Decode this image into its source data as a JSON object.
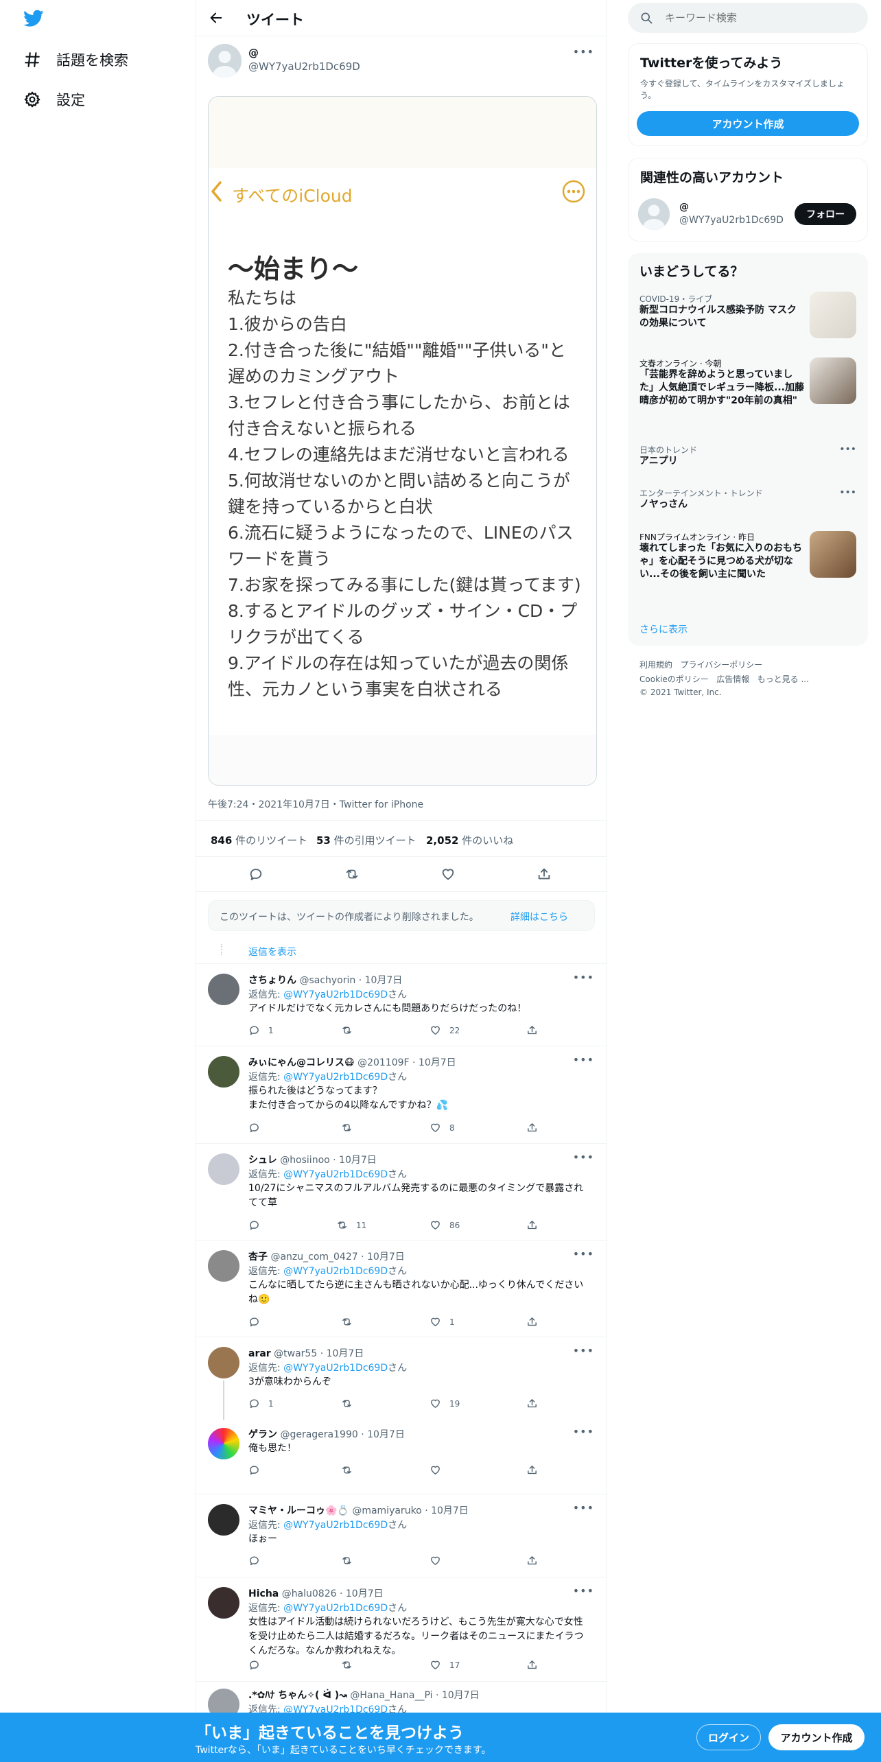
{
  "nav": {
    "explore_label": "話題を検索",
    "settings_label": "設定"
  },
  "header": {
    "title": "ツイート"
  },
  "tweet": {
    "name": "@",
    "handle": "@WY7yaU2rb1Dc69D",
    "image": {
      "back_label": "すべてのiCloud",
      "heading": "〜始まり〜",
      "lines": [
        "私たちは",
        "1.彼からの告白",
        "2.付き合った後に\"結婚\"\"離婚\"\"子供いる\"と",
        "遅めのカミングアウト",
        "3.セフレと付き合う事にしたから、お前とは",
        "付き合えないと振られる",
        "4.セフレの連絡先はまだ消せないと言われる",
        "5.何故消せないのかと問い詰めると向こうが",
        "鍵を持っているからと白状",
        "6.流石に疑うようになったので、LINEのパス",
        "ワードを貰う",
        "7.お家を探ってみる事にした(鍵は貰ってます)",
        "8.するとアイドルのグッズ・サイン・CD・プ",
        "リクラが出てくる",
        "9.アイドルの存在は知っていたが過去の関係",
        "性、元カノという事実を白状される"
      ]
    },
    "meta": "午後7:24・2021年10月7日・Twitter for iPhone",
    "stats": {
      "retweets": "846",
      "retweets_label": "件のリツイート",
      "quotes": "53",
      "quotes_label": "件の引用ツイート",
      "likes": "2,052",
      "likes_label": "件のいいね"
    },
    "deleted_notice": "このツイートは、ツイートの作成者により削除されました。",
    "deleted_link": "詳細はこちら",
    "show_replies": "返信を表示"
  },
  "replies": [
    {
      "name": "さちょりん",
      "handle": "@sachyorin · 10月7日",
      "to_prefix": "返信先: ",
      "to": "@WY7yaU2rb1Dc69D",
      "to_suffix": "さん",
      "text": "アイドルだけでなく元カレさんにも問題ありだらけだったのね！",
      "reply_count": "1",
      "rt_count": "",
      "like_count": "22"
    },
    {
      "name": "みぃにゃん@コレリス😷",
      "handle": "@201109F · 10月7日",
      "to_prefix": "返信先: ",
      "to": "@WY7yaU2rb1Dc69D",
      "to_suffix": "さん",
      "text": "振られた後はどうなってます？\nまた付き合ってからの4以降なんですかね？💦",
      "reply_count": "",
      "rt_count": "",
      "like_count": "8"
    },
    {
      "name": "シュレ",
      "handle": "@hosiinoo · 10月7日",
      "to_prefix": "返信先: ",
      "to": "@WY7yaU2rb1Dc69D",
      "to_suffix": "さん",
      "text": "10/27にシャニマスのフルアルバム発売するのに最悪のタイミングで暴露されてて草",
      "reply_count": "",
      "rt_count": "11",
      "like_count": "86"
    },
    {
      "name": "杏子",
      "handle": "@anzu_com_0427 · 10月7日",
      "to_prefix": "返信先: ",
      "to": "@WY7yaU2rb1Dc69D",
      "to_suffix": "さん",
      "text": "こんなに晒してたら逆に主さんも晒されないか心配...ゆっくり休んでくださいね🙂",
      "reply_count": "",
      "rt_count": "",
      "like_count": "1"
    },
    {
      "name": "arar",
      "handle": "@twar55 · 10月7日",
      "to_prefix": "返信先: ",
      "to": "@WY7yaU2rb1Dc69D",
      "to_suffix": "さん",
      "text": "3が意味わからんぞ",
      "reply_count": "1",
      "rt_count": "",
      "like_count": "19"
    },
    {
      "name": "ゲラン",
      "handle": "@geragera1990 · 10月7日",
      "to_prefix": "",
      "to": "",
      "to_suffix": "",
      "text": "俺も思た！",
      "reply_count": "",
      "rt_count": "",
      "like_count": ""
    },
    {
      "name": "マミヤ・ルーコゥ🌸💍",
      "handle": "@mamiyaruko · 10月7日",
      "to_prefix": "返信先: ",
      "to": "@WY7yaU2rb1Dc69D",
      "to_suffix": "さん",
      "text": "ほぉー",
      "reply_count": "",
      "rt_count": "",
      "like_count": ""
    },
    {
      "name": "Hicha",
      "handle": "@halu0826 · 10月7日",
      "to_prefix": "返信先: ",
      "to": "@WY7yaU2rb1Dc69D",
      "to_suffix": "さん",
      "text": "女性はアイドル活動は続けられないだろうけど、もこう先生が寛大な心で女性を受け止めたら二人は結婚するだろな。リーク者はそのニュースにまたイラつくんだろな。なんか救われねえな。",
      "reply_count": "",
      "rt_count": "",
      "like_count": "17"
    },
    {
      "name": ".*✿ﾊﾅ ちゃん✧( ᐛ )↝",
      "handle": "@Hana_Hana__Pi · 10月7日",
      "to_prefix": "返信先: ",
      "to": "@WY7yaU2rb1Dc69D",
      "to_suffix": "さん",
      "text": "",
      "reply_count": "",
      "rt_count": "",
      "like_count": ""
    }
  ],
  "sidebar": {
    "search_placeholder": "キーワード検索",
    "signup": {
      "title": "Twitterを使ってみよう",
      "desc": "今すぐ登録して、タイムラインをカスタマイズしましょう。",
      "button": "アカウント作成"
    },
    "related": {
      "title": "関連性の高いアカウント",
      "name": "@",
      "handle": "@WY7yaU2rb1Dc69D",
      "follow": "フォロー"
    },
    "trends": {
      "title": "いまどうしてる？",
      "items": [
        {
          "meta": "COVID-19・ライブ",
          "title": "新型コロナウイルス感染予防 マスクの効果について"
        },
        {
          "meta": "文春オンライン · 今朝",
          "title": "「芸能界を辞めようと思っていました」人気絶頂でレギュラー降板...加藤晴彦が初めて明かす\"20年前の真相\""
        },
        {
          "meta": "日本のトレンド",
          "title": "アニプリ"
        },
        {
          "meta": "エンターテインメント・トレンド",
          "title": "ノヤっさん"
        },
        {
          "meta": "FNNプライムオンライン · 昨日",
          "title": "壊れてしまった「お気に入りのおもちゃ」を心配そうに見つめる犬が切ない...その後を飼い主に聞いた"
        }
      ],
      "more": "さらに表示"
    },
    "footer": {
      "links1": [
        "利用規約",
        "プライバシーポリシー"
      ],
      "links2": [
        "Cookieのポリシー",
        "広告情報",
        "もっと見る ..."
      ],
      "copyright": "© 2021 Twitter, Inc."
    }
  },
  "bottom": {
    "title": "「いま」起きていることを見つけよう",
    "subtitle": "Twitterなら、「いま」起きていることをいち早くチェックできます。",
    "login": "ログイン",
    "signup": "アカウント作成"
  },
  "colors": {
    "accent": "#1d9bf0",
    "note_accent": "#e0a82e"
  }
}
